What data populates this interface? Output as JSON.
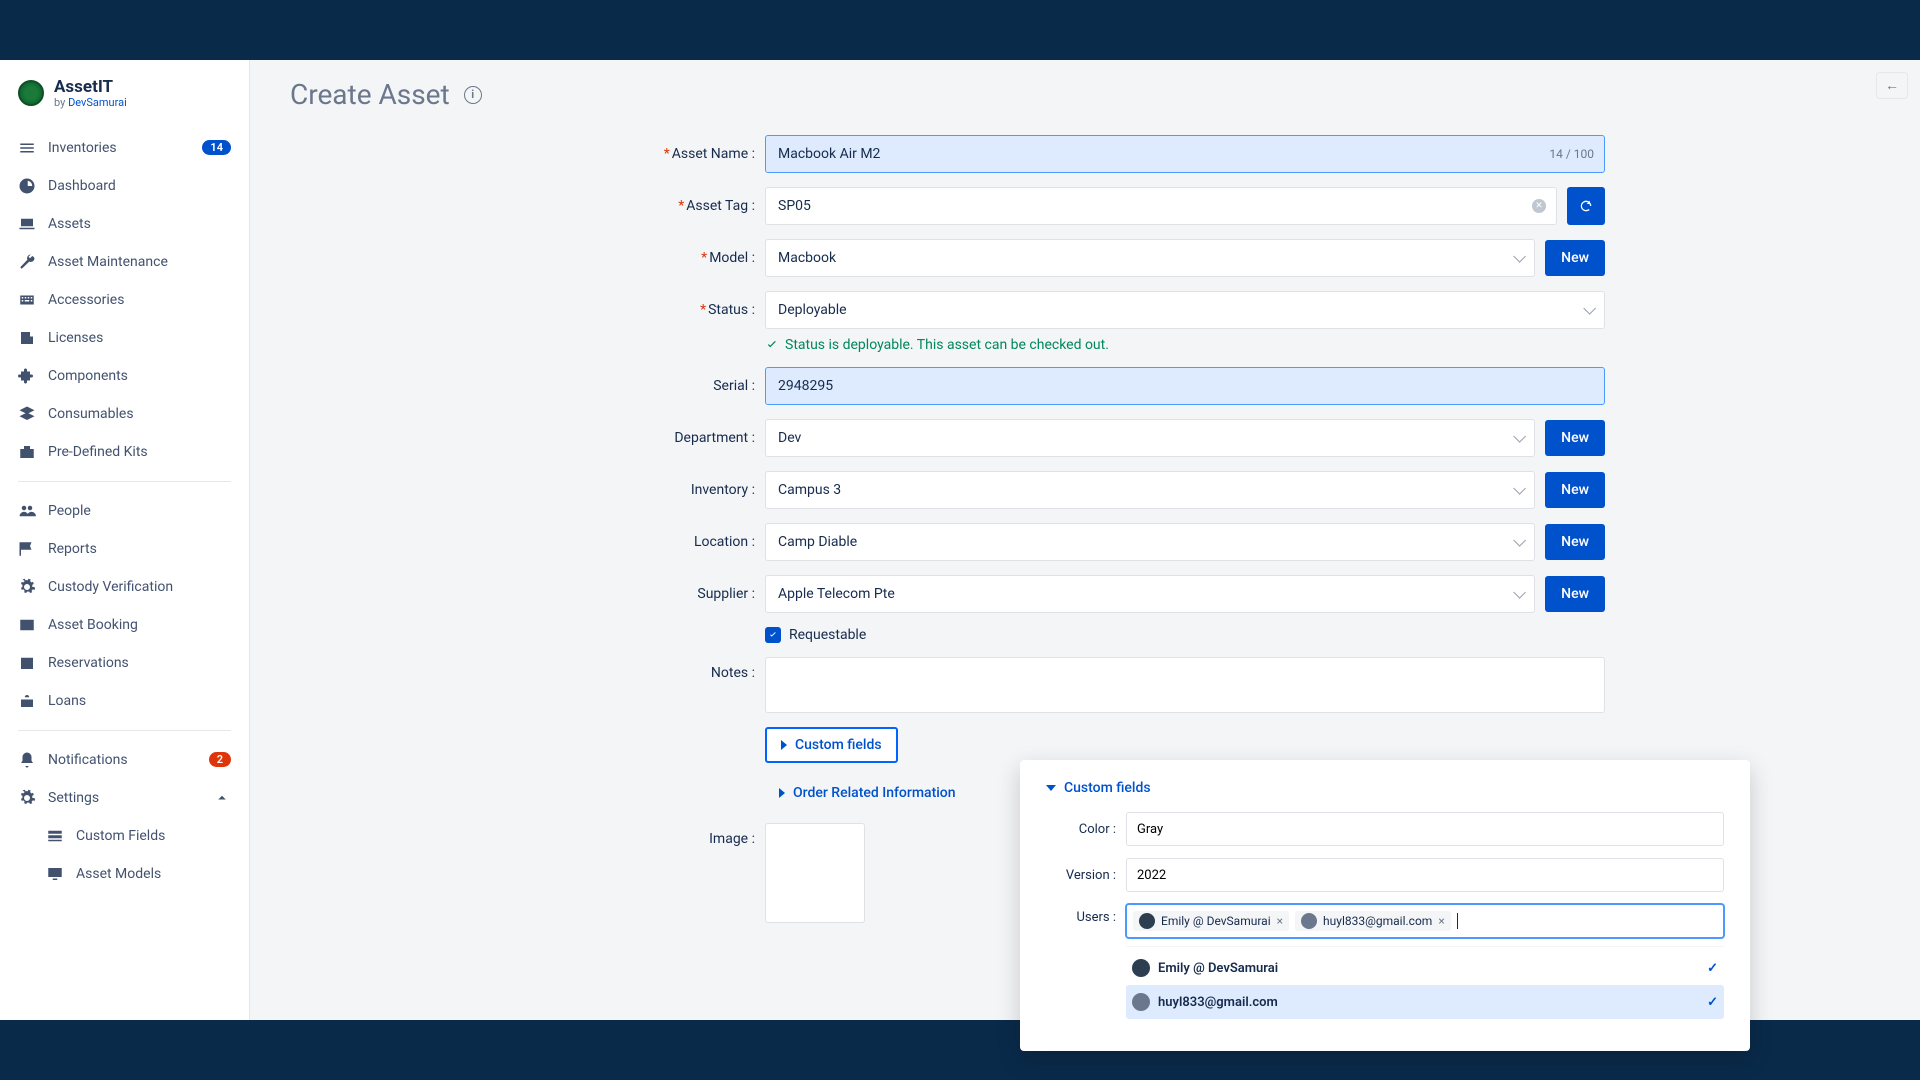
{
  "brand": {
    "title": "AssetIT",
    "by": "by ",
    "vendor": "DevSamurai"
  },
  "nav": {
    "inventories": "Inventories",
    "inventories_badge": "14",
    "dashboard": "Dashboard",
    "assets": "Assets",
    "maintenance": "Asset Maintenance",
    "accessories": "Accessories",
    "licenses": "Licenses",
    "components": "Components",
    "consumables": "Consumables",
    "kits": "Pre-Defined Kits",
    "people": "People",
    "reports": "Reports",
    "custody": "Custody Verification",
    "booking": "Asset Booking",
    "reservations": "Reservations",
    "loans": "Loans",
    "notifications": "Notifications",
    "notifications_badge": "2",
    "settings": "Settings",
    "custom_fields": "Custom Fields",
    "asset_models": "Asset Models"
  },
  "page": {
    "title": "Create Asset"
  },
  "form": {
    "asset_name": {
      "label": "Asset Name",
      "value": "Macbook Air M2",
      "counter": "14 / 100"
    },
    "asset_tag": {
      "label": "Asset Tag",
      "value": "SP05"
    },
    "model": {
      "label": "Model",
      "value": "Macbook"
    },
    "status": {
      "label": "Status",
      "value": "Deployable"
    },
    "status_msg": "Status is deployable. This asset can be checked out.",
    "serial": {
      "label": "Serial",
      "value": "2948295"
    },
    "department": {
      "label": "Department",
      "value": "Dev"
    },
    "inventory": {
      "label": "Inventory",
      "value": "Campus 3"
    },
    "location": {
      "label": "Location",
      "value": "Camp Diable"
    },
    "supplier": {
      "label": "Supplier",
      "value": "Apple Telecom Pte"
    },
    "requestable": "Requestable",
    "notes": {
      "label": "Notes"
    },
    "custom_fields": "Custom fields",
    "order_info": "Order Related Information",
    "image": {
      "label": "Image"
    },
    "new_btn": "New"
  },
  "popup": {
    "title": "Custom fields",
    "color": {
      "label": "Color",
      "value": "Gray"
    },
    "version": {
      "label": "Version",
      "value": "2022"
    },
    "users": {
      "label": "Users",
      "chips": [
        "Emily @ DevSamurai",
        "huyl833@gmail.com"
      ],
      "options": [
        "Emily @ DevSamurai",
        "huyl833@gmail.com"
      ]
    }
  }
}
